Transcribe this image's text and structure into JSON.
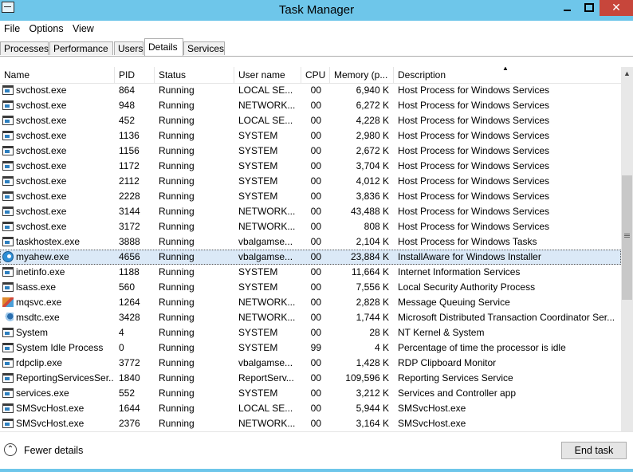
{
  "window": {
    "title": "Task Manager"
  },
  "menu": [
    "File",
    "Options",
    "View"
  ],
  "tabs": [
    "Processes",
    "Performance",
    "Users",
    "Details",
    "Services"
  ],
  "active_tab": "Details",
  "columns": {
    "name": "Name",
    "pid": "PID",
    "status": "Status",
    "user": "User name",
    "cpu": "CPU",
    "memory": "Memory (p...",
    "description": "Description"
  },
  "rows": [
    {
      "name": "svchost.exe",
      "pid": "864",
      "status": "Running",
      "user": "LOCAL SE...",
      "cpu": "00",
      "memory": "6,940 K",
      "description": "Host Process for Windows Services",
      "icon": "app"
    },
    {
      "name": "svchost.exe",
      "pid": "948",
      "status": "Running",
      "user": "NETWORK...",
      "cpu": "00",
      "memory": "6,272 K",
      "description": "Host Process for Windows Services",
      "icon": "app"
    },
    {
      "name": "svchost.exe",
      "pid": "452",
      "status": "Running",
      "user": "LOCAL SE...",
      "cpu": "00",
      "memory": "4,228 K",
      "description": "Host Process for Windows Services",
      "icon": "app"
    },
    {
      "name": "svchost.exe",
      "pid": "1136",
      "status": "Running",
      "user": "SYSTEM",
      "cpu": "00",
      "memory": "2,980 K",
      "description": "Host Process for Windows Services",
      "icon": "app"
    },
    {
      "name": "svchost.exe",
      "pid": "1156",
      "status": "Running",
      "user": "SYSTEM",
      "cpu": "00",
      "memory": "2,672 K",
      "description": "Host Process for Windows Services",
      "icon": "app"
    },
    {
      "name": "svchost.exe",
      "pid": "1172",
      "status": "Running",
      "user": "SYSTEM",
      "cpu": "00",
      "memory": "3,704 K",
      "description": "Host Process for Windows Services",
      "icon": "app"
    },
    {
      "name": "svchost.exe",
      "pid": "2112",
      "status": "Running",
      "user": "SYSTEM",
      "cpu": "00",
      "memory": "4,012 K",
      "description": "Host Process for Windows Services",
      "icon": "app"
    },
    {
      "name": "svchost.exe",
      "pid": "2228",
      "status": "Running",
      "user": "SYSTEM",
      "cpu": "00",
      "memory": "3,836 K",
      "description": "Host Process for Windows Services",
      "icon": "app"
    },
    {
      "name": "svchost.exe",
      "pid": "3144",
      "status": "Running",
      "user": "NETWORK...",
      "cpu": "00",
      "memory": "43,488 K",
      "description": "Host Process for Windows Services",
      "icon": "app"
    },
    {
      "name": "svchost.exe",
      "pid": "3172",
      "status": "Running",
      "user": "NETWORK...",
      "cpu": "00",
      "memory": "808 K",
      "description": "Host Process for Windows Services",
      "icon": "app"
    },
    {
      "name": "taskhostex.exe",
      "pid": "3888",
      "status": "Running",
      "user": "vbalgamse...",
      "cpu": "00",
      "memory": "2,104 K",
      "description": "Host Process for Windows Tasks",
      "icon": "app"
    },
    {
      "name": "myahew.exe",
      "pid": "4656",
      "status": "Running",
      "user": "vbalgamse...",
      "cpu": "00",
      "memory": "23,884 K",
      "description": "InstallAware for Windows Installer",
      "icon": "globe",
      "selected": true
    },
    {
      "name": "inetinfo.exe",
      "pid": "1188",
      "status": "Running",
      "user": "SYSTEM",
      "cpu": "00",
      "memory": "11,664 K",
      "description": "Internet Information Services",
      "icon": "app"
    },
    {
      "name": "lsass.exe",
      "pid": "560",
      "status": "Running",
      "user": "SYSTEM",
      "cpu": "00",
      "memory": "7,556 K",
      "description": "Local Security Authority Process",
      "icon": "app"
    },
    {
      "name": "mqsvc.exe",
      "pid": "1264",
      "status": "Running",
      "user": "NETWORK...",
      "cpu": "00",
      "memory": "2,828 K",
      "description": "Message Queuing Service",
      "icon": "queue"
    },
    {
      "name": "msdtc.exe",
      "pid": "3428",
      "status": "Running",
      "user": "NETWORK...",
      "cpu": "00",
      "memory": "1,744 K",
      "description": "Microsoft Distributed Transaction Coordinator Ser...",
      "icon": "dtc"
    },
    {
      "name": "System",
      "pid": "4",
      "status": "Running",
      "user": "SYSTEM",
      "cpu": "00",
      "memory": "28 K",
      "description": "NT Kernel & System",
      "icon": "app"
    },
    {
      "name": "System Idle Process",
      "pid": "0",
      "status": "Running",
      "user": "SYSTEM",
      "cpu": "99",
      "memory": "4 K",
      "description": "Percentage of time the processor is idle",
      "icon": "app"
    },
    {
      "name": "rdpclip.exe",
      "pid": "3772",
      "status": "Running",
      "user": "vbalgamse...",
      "cpu": "00",
      "memory": "1,428 K",
      "description": "RDP Clipboard Monitor",
      "icon": "app"
    },
    {
      "name": "ReportingServicesSer...",
      "pid": "1840",
      "status": "Running",
      "user": "ReportServ...",
      "cpu": "00",
      "memory": "109,596 K",
      "description": "Reporting Services Service",
      "icon": "app"
    },
    {
      "name": "services.exe",
      "pid": "552",
      "status": "Running",
      "user": "SYSTEM",
      "cpu": "00",
      "memory": "3,212 K",
      "description": "Services and Controller app",
      "icon": "app"
    },
    {
      "name": "SMSvcHost.exe",
      "pid": "1644",
      "status": "Running",
      "user": "LOCAL SE...",
      "cpu": "00",
      "memory": "5,944 K",
      "description": "SMSvcHost.exe",
      "icon": "app"
    },
    {
      "name": "SMSvcHost.exe",
      "pid": "2376",
      "status": "Running",
      "user": "NETWORK...",
      "cpu": "00",
      "memory": "3,164 K",
      "description": "SMSvcHost.exe",
      "icon": "app"
    }
  ],
  "footer": {
    "fewer_details": "Fewer details",
    "end_task": "End task"
  },
  "colors": {
    "titlebar": "#6ec6ea",
    "close_button": "#c7463b",
    "selection": "#dbe9f7"
  }
}
